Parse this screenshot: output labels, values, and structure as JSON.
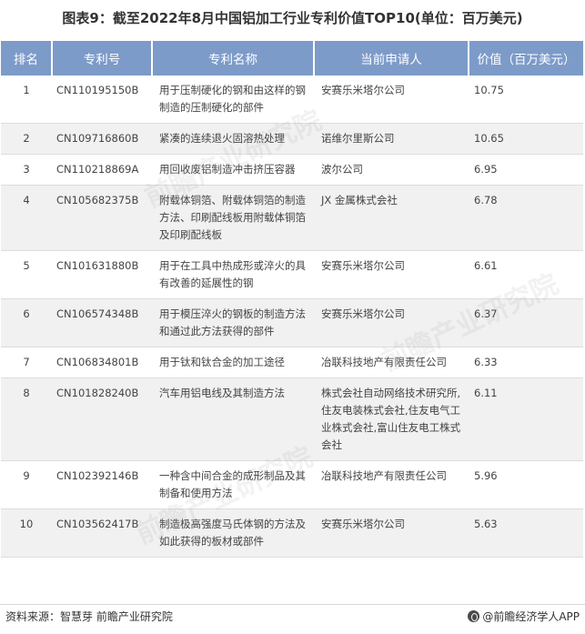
{
  "title": "图表9：截至2022年8月中国铝加工行业专利价值TOP10(单位：百万美元)",
  "headers": [
    "排名",
    "专利号",
    "专利名称",
    "当前申请人",
    "价值（百万美元）"
  ],
  "rows": [
    {
      "rank": "1",
      "patent_no": "CN110195150B",
      "name": "用于压制硬化的钢和由这样的钢制造的压制硬化的部件",
      "owner": "安赛乐米塔尔公司",
      "value": "10.75"
    },
    {
      "rank": "2",
      "patent_no": "CN109716860B",
      "name": "紧凑的连续退火固溶热处理",
      "owner": "诺维尔里斯公司",
      "value": "10.65"
    },
    {
      "rank": "3",
      "patent_no": "CN110218869A",
      "name": "用回收废铝制造冲击挤压容器",
      "owner": "波尔公司",
      "value": "6.95"
    },
    {
      "rank": "4",
      "patent_no": "CN105682375B",
      "name": "附载体铜箔、附载体铜箔的制造方法、印刷配线板用附载体铜箔及印刷配线板",
      "owner": "JX 金属株式会社",
      "value": "6.78"
    },
    {
      "rank": "5",
      "patent_no": "CN101631880B",
      "name": "用于在工具中热成形或淬火的具有改善的延展性的钢",
      "owner": "安赛乐米塔尔公司",
      "value": "6.61"
    },
    {
      "rank": "6",
      "patent_no": "CN106574348B",
      "name": "用于模压淬火的钢板的制造方法和通过此方法获得的部件",
      "owner": "安赛乐米塔尔公司",
      "value": "6.37"
    },
    {
      "rank": "7",
      "patent_no": "CN106834801B",
      "name": "用于钛和钛合金的加工途径",
      "owner": "冶联科技地产有限责任公司",
      "value": "6.33"
    },
    {
      "rank": "8",
      "patent_no": "CN101828240B",
      "name": "汽车用铝电线及其制造方法",
      "owner": "株式会社自动网络技术研究所,住友电装株式会社,住友电气工业株式会社,富山住友电工株式会社",
      "value": "6.11"
    },
    {
      "rank": "9",
      "patent_no": "CN102392146B",
      "name": "一种含中间合金的成形制品及其制备和使用方法",
      "owner": "冶联科技地产有限责任公司",
      "value": "5.96"
    },
    {
      "rank": "10",
      "patent_no": "CN103562417B",
      "name": "制造极高强度马氏体钢的方法及如此获得的板材或部件",
      "owner": "安赛乐米塔尔公司",
      "value": "5.63"
    }
  ],
  "footer": {
    "source": "资料来源：智慧芽 前瞻产业研究院",
    "brand": "@前瞻经济学人APP"
  },
  "watermark": "前瞻产业研究院"
}
